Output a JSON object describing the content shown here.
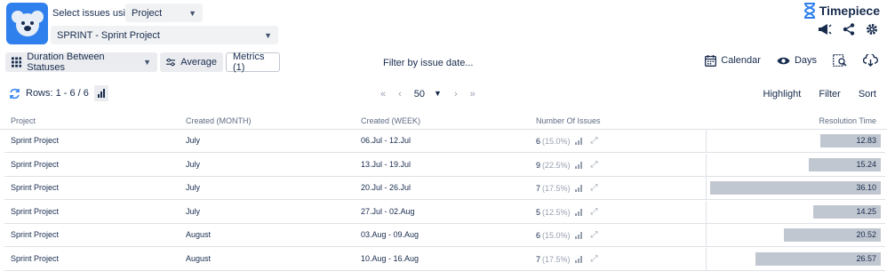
{
  "header": {
    "select_label": "Select issues using",
    "source_select": "Project",
    "project_select": "SPRINT - Sprint Project",
    "brand": "Timepiece"
  },
  "toolbar": {
    "duration": "Duration Between Statuses",
    "average": "Average",
    "metrics": "Metrics (1)",
    "filter_date": "Filter by issue date...",
    "calendar": "Calendar",
    "days": "Days"
  },
  "table_controls": {
    "rows": "Rows: 1 - 6 / 6",
    "page_size": "50",
    "highlight": "Highlight",
    "filter": "Filter",
    "sort": "Sort"
  },
  "columns": [
    "Project",
    "Created (MONTH)",
    "Created (WEEK)",
    "Number Of Issues",
    "Resolution Time"
  ],
  "rows": [
    {
      "project": "Sprint Project",
      "month": "July",
      "week": "06.Jul - 12.Jul",
      "count": "6",
      "pct": "(15.0%)",
      "res": "12.83",
      "res_value": 12.83
    },
    {
      "project": "Sprint Project",
      "month": "July",
      "week": "13.Jul - 19.Jul",
      "count": "9",
      "pct": "(22.5%)",
      "res": "15.24",
      "res_value": 15.24
    },
    {
      "project": "Sprint Project",
      "month": "July",
      "week": "20.Jul - 26.Jul",
      "count": "7",
      "pct": "(17.5%)",
      "res": "36.10",
      "res_value": 36.1
    },
    {
      "project": "Sprint Project",
      "month": "July",
      "week": "27.Jul - 02.Aug",
      "count": "5",
      "pct": "(12.5%)",
      "res": "14.25",
      "res_value": 14.25
    },
    {
      "project": "Sprint Project",
      "month": "August",
      "week": "03.Aug - 09.Aug",
      "count": "6",
      "pct": "(15.0%)",
      "res": "20.52",
      "res_value": 20.52
    },
    {
      "project": "Sprint Project",
      "month": "August",
      "week": "10.Aug - 16.Aug",
      "count": "7",
      "pct": "(17.5%)",
      "res": "26.57",
      "res_value": 26.57
    }
  ],
  "colors": {
    "accent": "#2f80ed",
    "bar": "#c1c7d0"
  }
}
